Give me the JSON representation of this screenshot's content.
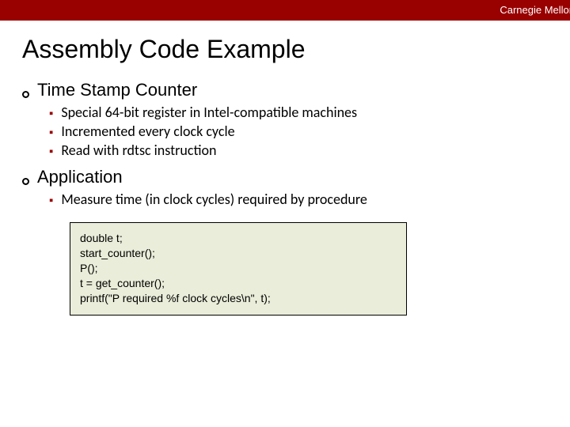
{
  "banner": {
    "org": "Carnegie Mellon"
  },
  "title": "Assembly Code Example",
  "sections": [
    {
      "heading": "Time Stamp Counter",
      "items": [
        "Special 64-bit register in Intel-compatible machines",
        "Incremented every clock cycle",
        "Read with rdtsc instruction"
      ]
    },
    {
      "heading": "Application",
      "items": [
        "Measure time (in clock cycles) required by procedure"
      ]
    }
  ],
  "code": "double t;\nstart_counter();\nP();\nt = get_counter();\nprintf(\"P required %f clock cycles\\n\", t);"
}
